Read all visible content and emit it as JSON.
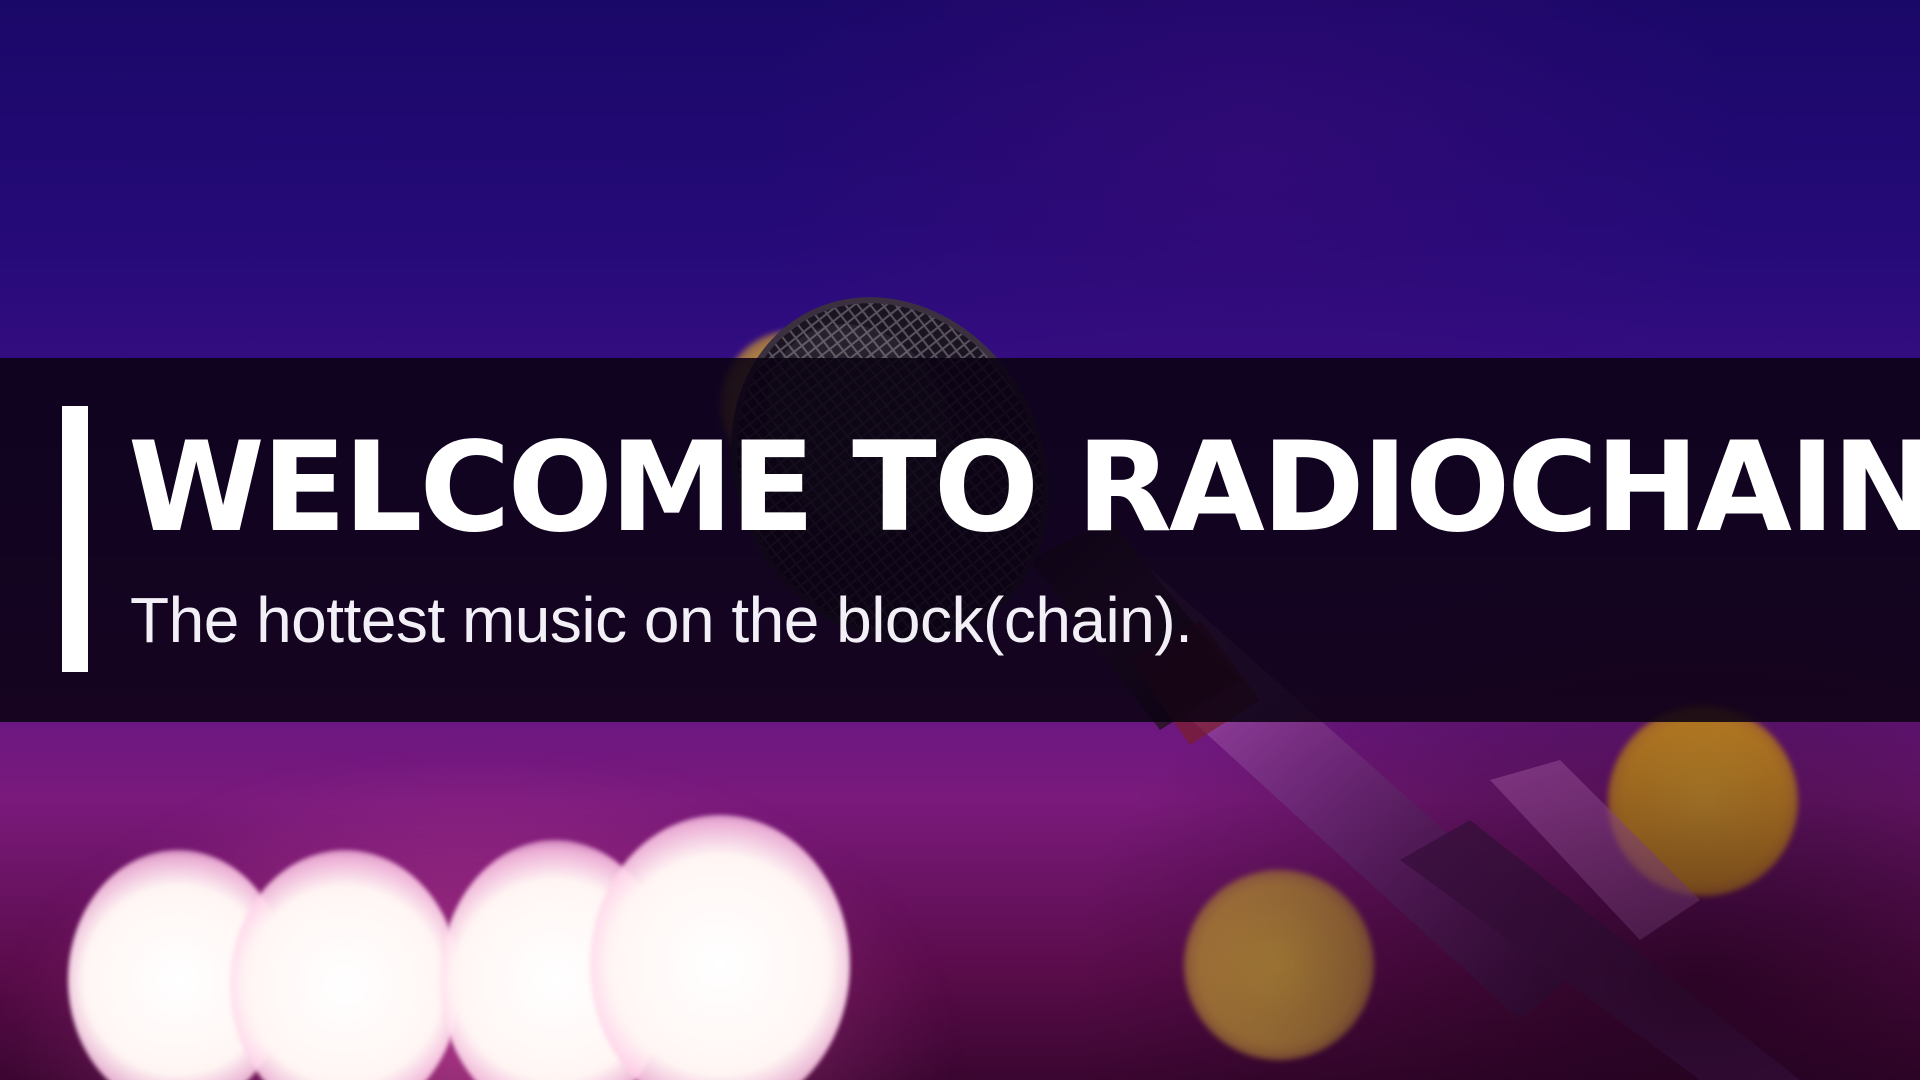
{
  "hero": {
    "title": "WELCOME TO RADIOCHAIN",
    "subtitle": "The hottest music on the block(chain)."
  },
  "colors": {
    "banner_bg": "#0a0212",
    "accent_bar": "#ffffff",
    "title_text": "#ffffff",
    "sky_top": "#1a0868",
    "sky_bottom": "#7a1a7c",
    "bokeh_amber": "#f2b52a"
  },
  "background_image": {
    "icon": "microphone-icon"
  }
}
